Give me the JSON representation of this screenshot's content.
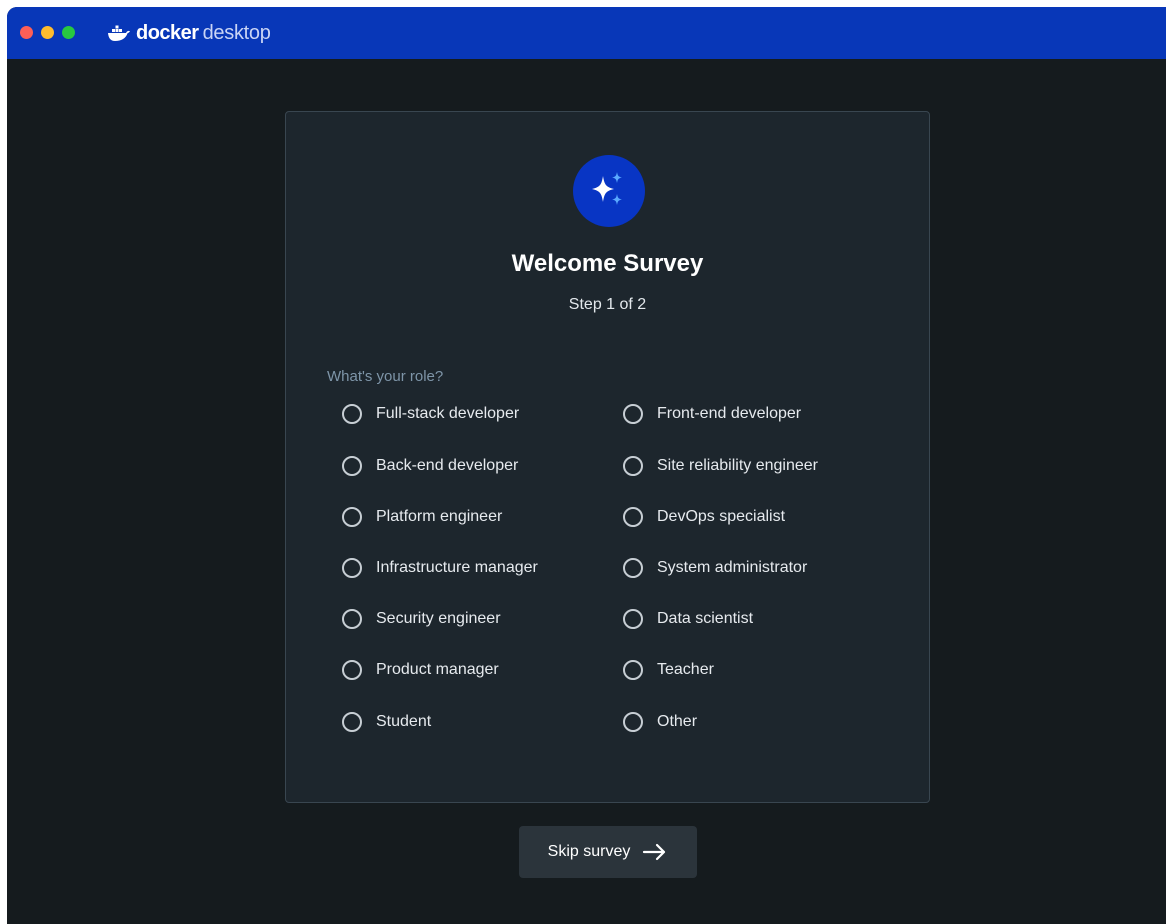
{
  "app": {
    "brand_bold": "docker",
    "brand_light": "desktop",
    "accent_color": "#0837b8"
  },
  "survey": {
    "title": "Welcome Survey",
    "step": "Step 1 of 2",
    "question": "What's your role?",
    "options_left": [
      "Full-stack developer",
      "Back-end developer",
      "Platform engineer",
      "Infrastructure manager",
      "Security engineer",
      "Product manager",
      "Student"
    ],
    "options_right": [
      "Front-end developer",
      "Site reliability engineer",
      "DevOps specialist",
      "System administrator",
      "Data scientist",
      "Teacher",
      "Other"
    ],
    "selected": null,
    "icon": "sparkles-icon"
  },
  "footer": {
    "skip_label": "Skip survey",
    "skip_icon": "arrow-right-icon"
  }
}
